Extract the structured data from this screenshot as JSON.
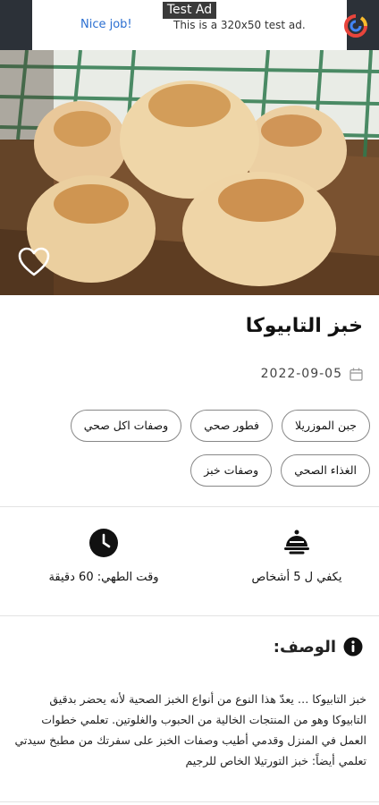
{
  "ad": {
    "tag": "Test Ad",
    "nice": "Nice job!",
    "text": "This is a 320x50 test ad."
  },
  "recipe": {
    "title": "خبز التابيوكا",
    "date": "2022-09-05",
    "tags": [
      "جبن الموزريلا",
      "فطور صحي",
      "وصفات اكل صحي",
      "الغذاء الصحي",
      "وصفات خبز"
    ],
    "servings": "يكفي ل 5 أشخاص",
    "cook_time": "وقت الطهي: 60 دقيقة",
    "description_heading": "الوصف:",
    "description": "خبز التابيوكا … يعدّ هذا النوع من أنواع الخبز الصحية لأنه يحضر بدقيق التابيوكا وهو من المنتجات الخالية من الحبوب والغلوتين. تعلمي خطوات العمل في المنزل وقدمي أطيب وصفات الخبز على سفرتك من مطبخ سيدتي تعلمي أيضاً: خبز التورتيلا الخاص للرجيم"
  },
  "icons": {
    "favorite": "heart-outline-icon",
    "calendar": "calendar-icon",
    "clock": "clock-icon",
    "servings": "serving-dish-icon",
    "info": "info-icon",
    "ad_logo": "ad-logo-icon"
  }
}
